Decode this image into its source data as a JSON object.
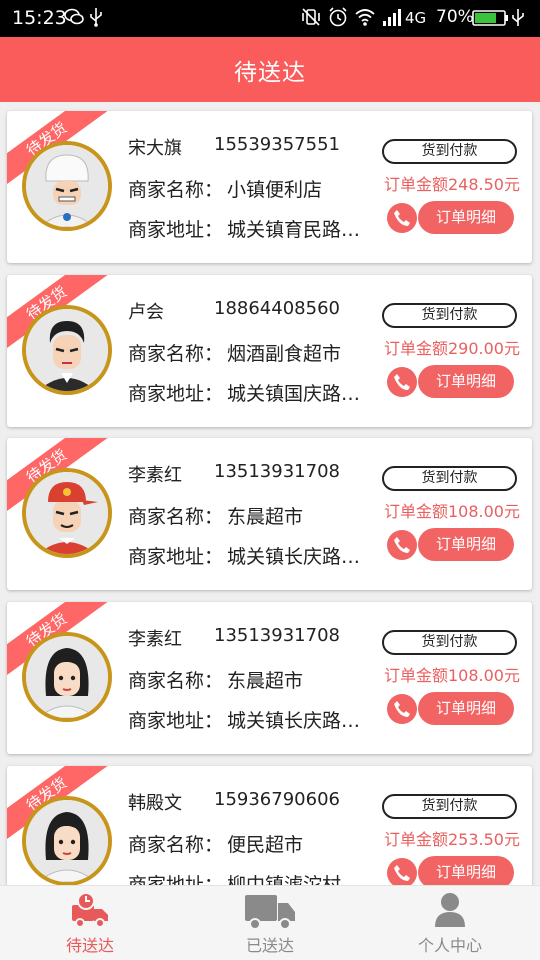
{
  "status_bar": {
    "time": "15:23",
    "network": "4G",
    "battery": "70%"
  },
  "header": {
    "title": "待送达"
  },
  "orders": [
    {
      "badge": "待发货",
      "avatar": "chef-boy",
      "name": "宋大旗",
      "phone": "15539357551",
      "shop_label": "商家名称：",
      "shop_name": "小镇便利店",
      "addr_label": "商家地址：",
      "address": "城关镇育民路…",
      "payment": "货到付款",
      "amount": "订单金额248.50元",
      "detail_label": "订单明细"
    },
    {
      "badge": "待发货",
      "avatar": "suit-man",
      "name": "卢会",
      "phone": "18864408560",
      "shop_label": "商家名称：",
      "shop_name": "烟酒副食超市",
      "addr_label": "商家地址：",
      "address": "城关镇国庆路…",
      "payment": "货到付款",
      "amount": "订单金额290.00元",
      "detail_label": "订单明细"
    },
    {
      "badge": "待发货",
      "avatar": "cap-man",
      "name": "李素红",
      "phone": "13513931708",
      "shop_label": "商家名称：",
      "shop_name": "东晨超市",
      "addr_label": "商家地址：",
      "address": "城关镇长庆路…",
      "payment": "货到付款",
      "amount": "订单金额108.00元",
      "detail_label": "订单明细"
    },
    {
      "badge": "待发货",
      "avatar": "woman",
      "name": "李素红",
      "phone": "13513931708",
      "shop_label": "商家名称：",
      "shop_name": "东晨超市",
      "addr_label": "商家地址：",
      "address": "城关镇长庆路…",
      "payment": "货到付款",
      "amount": "订单金额108.00元",
      "detail_label": "订单明细"
    },
    {
      "badge": "待发货",
      "avatar": "woman",
      "name": "韩殿文",
      "phone": "15936790606",
      "shop_label": "商家名称：",
      "shop_name": "便民超市",
      "addr_label": "商家地址：",
      "address": "柳中镇滤沱村",
      "payment": "货到付款",
      "amount": "订单金额253.50元",
      "detail_label": "订单明细"
    }
  ],
  "tabbar": {
    "tabs": [
      {
        "label": "待送达",
        "icon": "delivery-clock-icon",
        "active": true
      },
      {
        "label": "已送达",
        "icon": "truck-icon",
        "active": false
      },
      {
        "label": "个人中心",
        "icon": "person-icon",
        "active": false
      }
    ]
  },
  "colors": {
    "accent": "#fa5c5c",
    "amount": "#e96060",
    "badge_gold": "#c8951b",
    "inactive": "#8a8a8a"
  }
}
